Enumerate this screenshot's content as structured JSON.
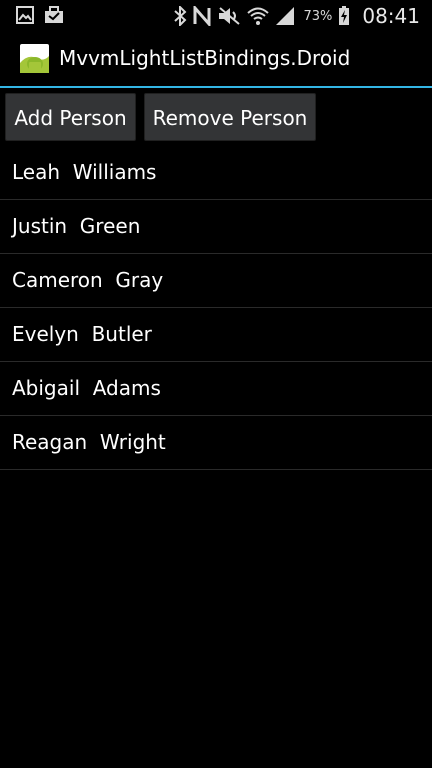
{
  "status_bar": {
    "icons_left": [
      "gallery-icon",
      "briefcase-icon"
    ],
    "icons_right": [
      "bluetooth-icon",
      "nfc-icon",
      "mute-icon",
      "wifi-icon",
      "signal-icon",
      "battery-icon"
    ],
    "battery_percent": "73%",
    "time": "08:41"
  },
  "action_bar": {
    "title": "MvvmLightListBindings.Droid",
    "accent_color": "#33b5e5"
  },
  "buttons": {
    "add_label": "Add Person",
    "remove_label": "Remove Person"
  },
  "people": [
    {
      "first": "Leah",
      "last": "Williams"
    },
    {
      "first": "Justin",
      "last": "Green"
    },
    {
      "first": "Cameron",
      "last": "Gray"
    },
    {
      "first": "Evelyn",
      "last": "Butler"
    },
    {
      "first": "Abigail",
      "last": "Adams"
    },
    {
      "first": "Reagan",
      "last": "Wright"
    }
  ]
}
